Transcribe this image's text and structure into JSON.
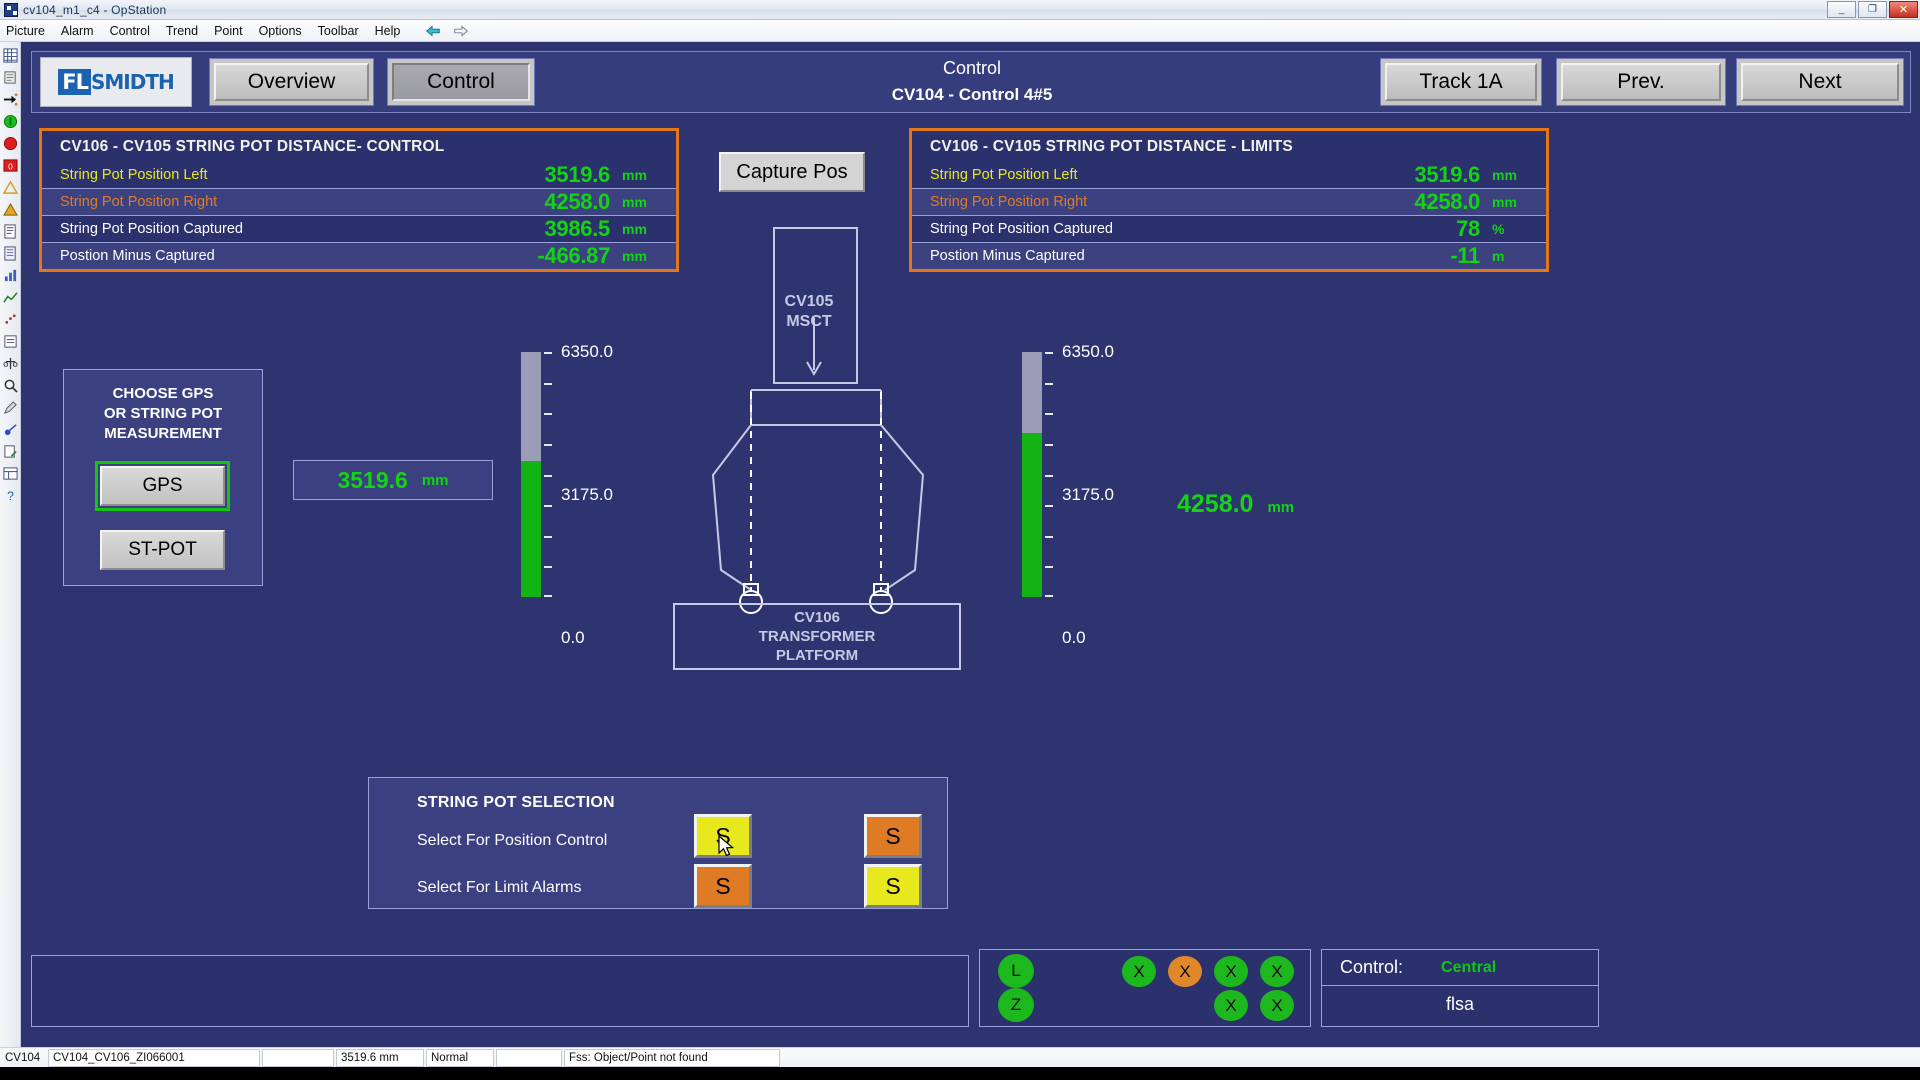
{
  "window": {
    "title": "cv104_m1_c4 - OpStation",
    "minimize": "_",
    "maximize": "❐",
    "close": "✕"
  },
  "menu": {
    "items": [
      "Picture",
      "Alarm",
      "Control",
      "Trend",
      "Point",
      "Options",
      "Toolbar",
      "Help"
    ]
  },
  "header": {
    "logo_fl": "FL",
    "logo_smidth": "SMIDTH",
    "overview_label": "Overview",
    "control_label": "Control",
    "title_line1": "Control",
    "title_line2": "CV104 - Control 4#5",
    "track_label": "Track 1A",
    "prev_label": "Prev.",
    "next_label": "Next"
  },
  "control_panel": {
    "title": "CV106 - CV105 STRING POT DISTANCE- CONTROL",
    "rows": [
      {
        "label": "String Pot Position Left",
        "value": "3519.6",
        "unit": "mm",
        "label_color": "#e8e81e"
      },
      {
        "label": "String Pot Position Right",
        "value": "4258.0",
        "unit": "mm",
        "label_color": "#e07b25"
      },
      {
        "label": "String Pot Position Captured",
        "value": "3986.5",
        "unit": "mm",
        "label_color": "#ffffff"
      },
      {
        "label": " Postion Minus Captured",
        "value": "-466.87",
        "unit": "mm",
        "label_color": "#ffffff"
      }
    ]
  },
  "limits_panel": {
    "title": "CV106 - CV105 STRING POT DISTANCE - LIMITS",
    "rows": [
      {
        "label": "String Pot Position Left",
        "value": "3519.6",
        "unit": "mm",
        "label_color": "#e8e81e"
      },
      {
        "label": "String Pot Position Right",
        "value": "4258.0",
        "unit": "mm",
        "label_color": "#e07b25"
      },
      {
        "label": "String Pot Position Captured",
        "value": "78",
        "unit": "%",
        "label_color": "#ffffff"
      },
      {
        "label": " Postion Minus Captured",
        "value": "-11",
        "unit": "m",
        "label_color": "#ffffff"
      }
    ]
  },
  "capture": {
    "label": "Capture Pos"
  },
  "gps_panel": {
    "title_line1": "CHOOSE GPS",
    "title_line2": "OR STRING POT",
    "title_line3": "MEASUREMENT",
    "gps_label": "GPS",
    "stpot_label": "ST-POT",
    "selected": "GPS",
    "select_color": "#12c512"
  },
  "left_gauge": {
    "max_label": "6350.0",
    "mid_label": "3175.0",
    "min_label": "0.0",
    "max": 6350.0,
    "min": 0.0,
    "value": 3519.6,
    "fill_color": "#12b312",
    "track_color": "#9a9cb8"
  },
  "right_gauge": {
    "max_label": "6350.0",
    "mid_label": "3175.0",
    "min_label": "0.0",
    "max": 6350.0,
    "min": 0.0,
    "value": 4258.0,
    "fill_color": "#12b312",
    "track_color": "#9a9cb8"
  },
  "left_readout": {
    "value": "3519.6",
    "unit": "mm"
  },
  "right_readout": {
    "value": "4258.0",
    "unit": "mm"
  },
  "diagram": {
    "mcst_line1": "CV105",
    "mcst_line2": "MSCT",
    "platform_line1": "CV106",
    "platform_line2": "TRANSFORMER",
    "platform_line3": "PLATFORM"
  },
  "string_pot_selection": {
    "title": "STRING POT SELECTION",
    "row1_label": "Select For Position Control",
    "row2_label": "Select For Limit Alarms",
    "buttons": [
      {
        "text": "S",
        "color": "#e8e81e",
        "row": 1,
        "side": "left"
      },
      {
        "text": "S",
        "color": "#e07b25",
        "row": 1,
        "side": "right"
      },
      {
        "text": "S",
        "color": "#e07b25",
        "row": 2,
        "side": "left"
      },
      {
        "text": "S",
        "color": "#e8e81e",
        "row": 2,
        "side": "right"
      }
    ]
  },
  "indicators": {
    "lz": [
      {
        "text": "L",
        "color": "#1db81d"
      },
      {
        "text": "Z",
        "color": "#1db81d"
      }
    ],
    "x_row1": [
      {
        "text": "X",
        "color": "#1db81d"
      },
      {
        "text": "X",
        "color": "#e0872a"
      },
      {
        "text": "X",
        "color": "#1db81d"
      },
      {
        "text": "X",
        "color": "#1db81d"
      }
    ],
    "x_row2": [
      {
        "text": "X",
        "color": "#1db81d"
      },
      {
        "text": "X",
        "color": "#1db81d"
      }
    ]
  },
  "control_status": {
    "key": "Control:",
    "value": "Central",
    "user": "flsa"
  },
  "statusbar": {
    "area": "CV104",
    "point": "CV104_CV106_ZI066001",
    "blank1": "",
    "value": "3519.6  mm",
    "state": "Normal",
    "blank2": "",
    "message": "Fss: Object/Point not found"
  }
}
